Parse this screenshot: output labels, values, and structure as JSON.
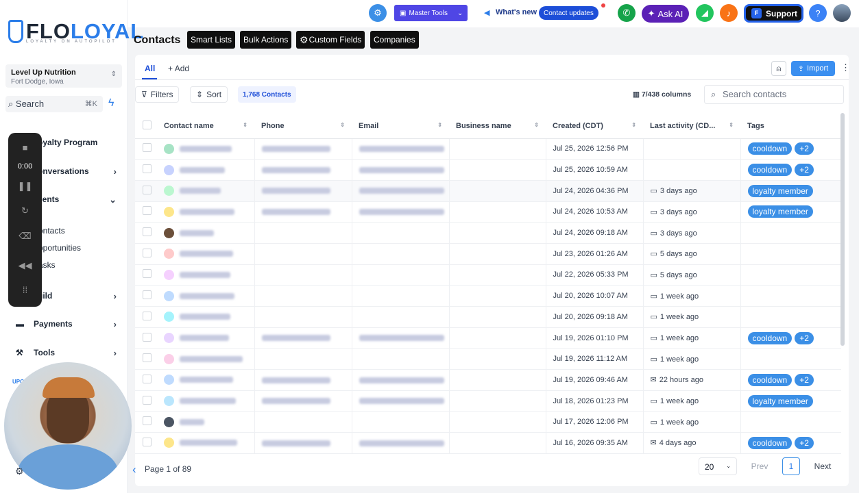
{
  "brand": {
    "logo_main": "FLO",
    "logo_accent": "LOYAL",
    "logo_tagline": "LOYALTY ON AUTOPILOT"
  },
  "location": {
    "name": "Level Up Nutrition",
    "city": "Fort Dodge, Iowa"
  },
  "sidebar_search": {
    "label": "Search",
    "shortcut": "⌘K"
  },
  "nav": [
    {
      "label": "oyalty Program"
    },
    {
      "label": "onversations"
    },
    {
      "label": "lients"
    },
    {
      "label": "uild"
    },
    {
      "label": "Payments"
    },
    {
      "label": "Tools"
    }
  ],
  "subnav": [
    "ontacts",
    "pportunities",
    "asks"
  ],
  "recorder": {
    "time": "0:00"
  },
  "upgrade": "UPG",
  "topbar": {
    "master_tools": "Master Tools",
    "whats_new": "What's new",
    "contact_updates": "Contact updates",
    "ask_ai": "Ask AI",
    "support": "Support",
    "help": "?"
  },
  "page": {
    "title": "Contacts",
    "header_buttons": [
      "Smart Lists",
      "Bulk Actions",
      "Custom Fields",
      "Companies"
    ]
  },
  "tabs": {
    "all": "All",
    "add": "Add"
  },
  "import_label": "Import",
  "filters": {
    "filters_label": "Filters",
    "sort_label": "Sort",
    "count": "1,768 Contacts",
    "columns": "7/438 columns",
    "search_placeholder": "Search contacts"
  },
  "columns": [
    "Contact name",
    "Phone",
    "Email",
    "Business name",
    "Created (CDT)",
    "Last activity (CD...",
    "Tags"
  ],
  "rows": [
    {
      "color": "#a7e3c5",
      "name_w": 76,
      "phone": true,
      "email": true,
      "created": "Jul 25, 2026 12:56 PM",
      "activity": "",
      "act_icon": "",
      "tags": [
        "cooldown",
        "+2"
      ]
    },
    {
      "color": "#c7d2fe",
      "name_w": 66,
      "phone": true,
      "email": true,
      "created": "Jul 25, 2026 10:59 AM",
      "activity": "",
      "act_icon": "",
      "tags": [
        "cooldown",
        "+2"
      ]
    },
    {
      "color": "#bbf7d0",
      "name_w": 60,
      "phone": true,
      "email": true,
      "created": "Jul 24, 2026 04:36 PM",
      "activity": "3 days ago",
      "act_icon": "chat",
      "tags": [
        "loyalty member"
      ]
    },
    {
      "color": "#fde68a",
      "name_w": 80,
      "phone": true,
      "email": true,
      "created": "Jul 24, 2026 10:53 AM",
      "activity": "3 days ago",
      "act_icon": "chat",
      "tags": [
        "loyalty member"
      ]
    },
    {
      "color": "#6b4f3a",
      "name_w": 50,
      "phone": false,
      "email": false,
      "created": "Jul 24, 2026 09:18 AM",
      "activity": "3 days ago",
      "act_icon": "chat",
      "tags": []
    },
    {
      "color": "#fecaca",
      "name_w": 78,
      "phone": false,
      "email": false,
      "created": "Jul 23, 2026 01:26 AM",
      "activity": "5 days ago",
      "act_icon": "chat",
      "tags": []
    },
    {
      "color": "#f5d0fe",
      "name_w": 74,
      "phone": false,
      "email": false,
      "created": "Jul 22, 2026 05:33 PM",
      "activity": "5 days ago",
      "act_icon": "chat",
      "tags": []
    },
    {
      "color": "#bfdbfe",
      "name_w": 80,
      "phone": false,
      "email": false,
      "created": "Jul 20, 2026 10:07 AM",
      "activity": "1 week ago",
      "act_icon": "chat",
      "tags": []
    },
    {
      "color": "#a5f3fc",
      "name_w": 74,
      "phone": false,
      "email": false,
      "created": "Jul 20, 2026 09:18 AM",
      "activity": "1 week ago",
      "act_icon": "chat",
      "tags": []
    },
    {
      "color": "#e9d5ff",
      "name_w": 72,
      "phone": true,
      "email": true,
      "created": "Jul 19, 2026 01:10 PM",
      "activity": "1 week ago",
      "act_icon": "chat",
      "tags": [
        "cooldown",
        "+2"
      ]
    },
    {
      "color": "#fbcfe8",
      "name_w": 92,
      "phone": false,
      "email": false,
      "created": "Jul 19, 2026 11:12 AM",
      "activity": "1 week ago",
      "act_icon": "chat",
      "tags": []
    },
    {
      "color": "#bfdbfe",
      "name_w": 78,
      "phone": true,
      "email": true,
      "created": "Jul 19, 2026 09:46 AM",
      "activity": "22 hours ago",
      "act_icon": "mail",
      "tags": [
        "cooldown",
        "+2"
      ]
    },
    {
      "color": "#bae6fd",
      "name_w": 82,
      "phone": true,
      "email": true,
      "created": "Jul 18, 2026 01:23 PM",
      "activity": "1 week ago",
      "act_icon": "chat",
      "tags": [
        "loyalty member"
      ]
    },
    {
      "color": "#4b5563",
      "name_w": 36,
      "phone": false,
      "email": false,
      "created": "Jul 17, 2026 12:06 PM",
      "activity": "1 week ago",
      "act_icon": "chat",
      "tags": []
    },
    {
      "color": "#fde68a",
      "name_w": 84,
      "phone": true,
      "email": true,
      "created": "Jul 16, 2026 09:35 AM",
      "activity": "4 days ago",
      "act_icon": "mail",
      "tags": [
        "cooldown",
        "+2"
      ]
    }
  ],
  "pagination": {
    "page_text": "Page 1 of 89",
    "per_page": "20",
    "prev": "Prev",
    "current": "1",
    "next": "Next"
  }
}
